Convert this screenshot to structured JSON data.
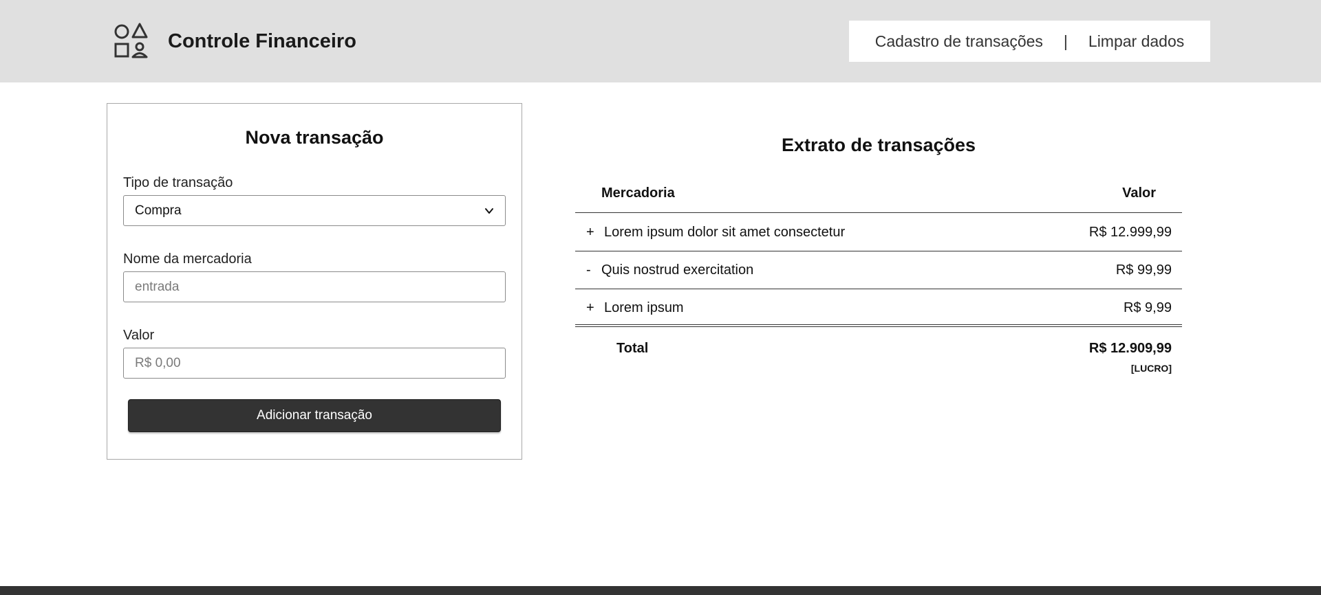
{
  "header": {
    "title": "Controle Financeiro",
    "logo_icon": "shapes-icon",
    "nav": {
      "cadastro": "Cadastro de transações",
      "separator": "|",
      "limpar": "Limpar dados"
    }
  },
  "form": {
    "title": "Nova transação",
    "tipo": {
      "label": "Tipo de transação",
      "selected": "Compra"
    },
    "nome": {
      "label": "Nome da mercadoria",
      "placeholder": "entrada"
    },
    "valor": {
      "label": "Valor",
      "placeholder": "R$ 0,00"
    },
    "submit_label": "Adicionar transação"
  },
  "statement": {
    "title": "Extrato de transações",
    "columns": {
      "merchandise": "Mercadoria",
      "value": "Valor"
    },
    "rows": [
      {
        "sign": "+",
        "name": "Lorem ipsum dolor sit amet consectetur",
        "value": "R$ 12.999,99"
      },
      {
        "sign": "-",
        "name": "Quis nostrud exercitation",
        "value": "R$ 99,99"
      },
      {
        "sign": "+",
        "name": "Lorem ipsum",
        "value": "R$ 9,99"
      }
    ],
    "total": {
      "label": "Total",
      "value": "R$ 12.909,99",
      "status": "[LUCRO]"
    }
  },
  "colors": {
    "header_bg": "#e0e0e0",
    "button_bg": "#333333",
    "footer_bg": "#333333"
  }
}
